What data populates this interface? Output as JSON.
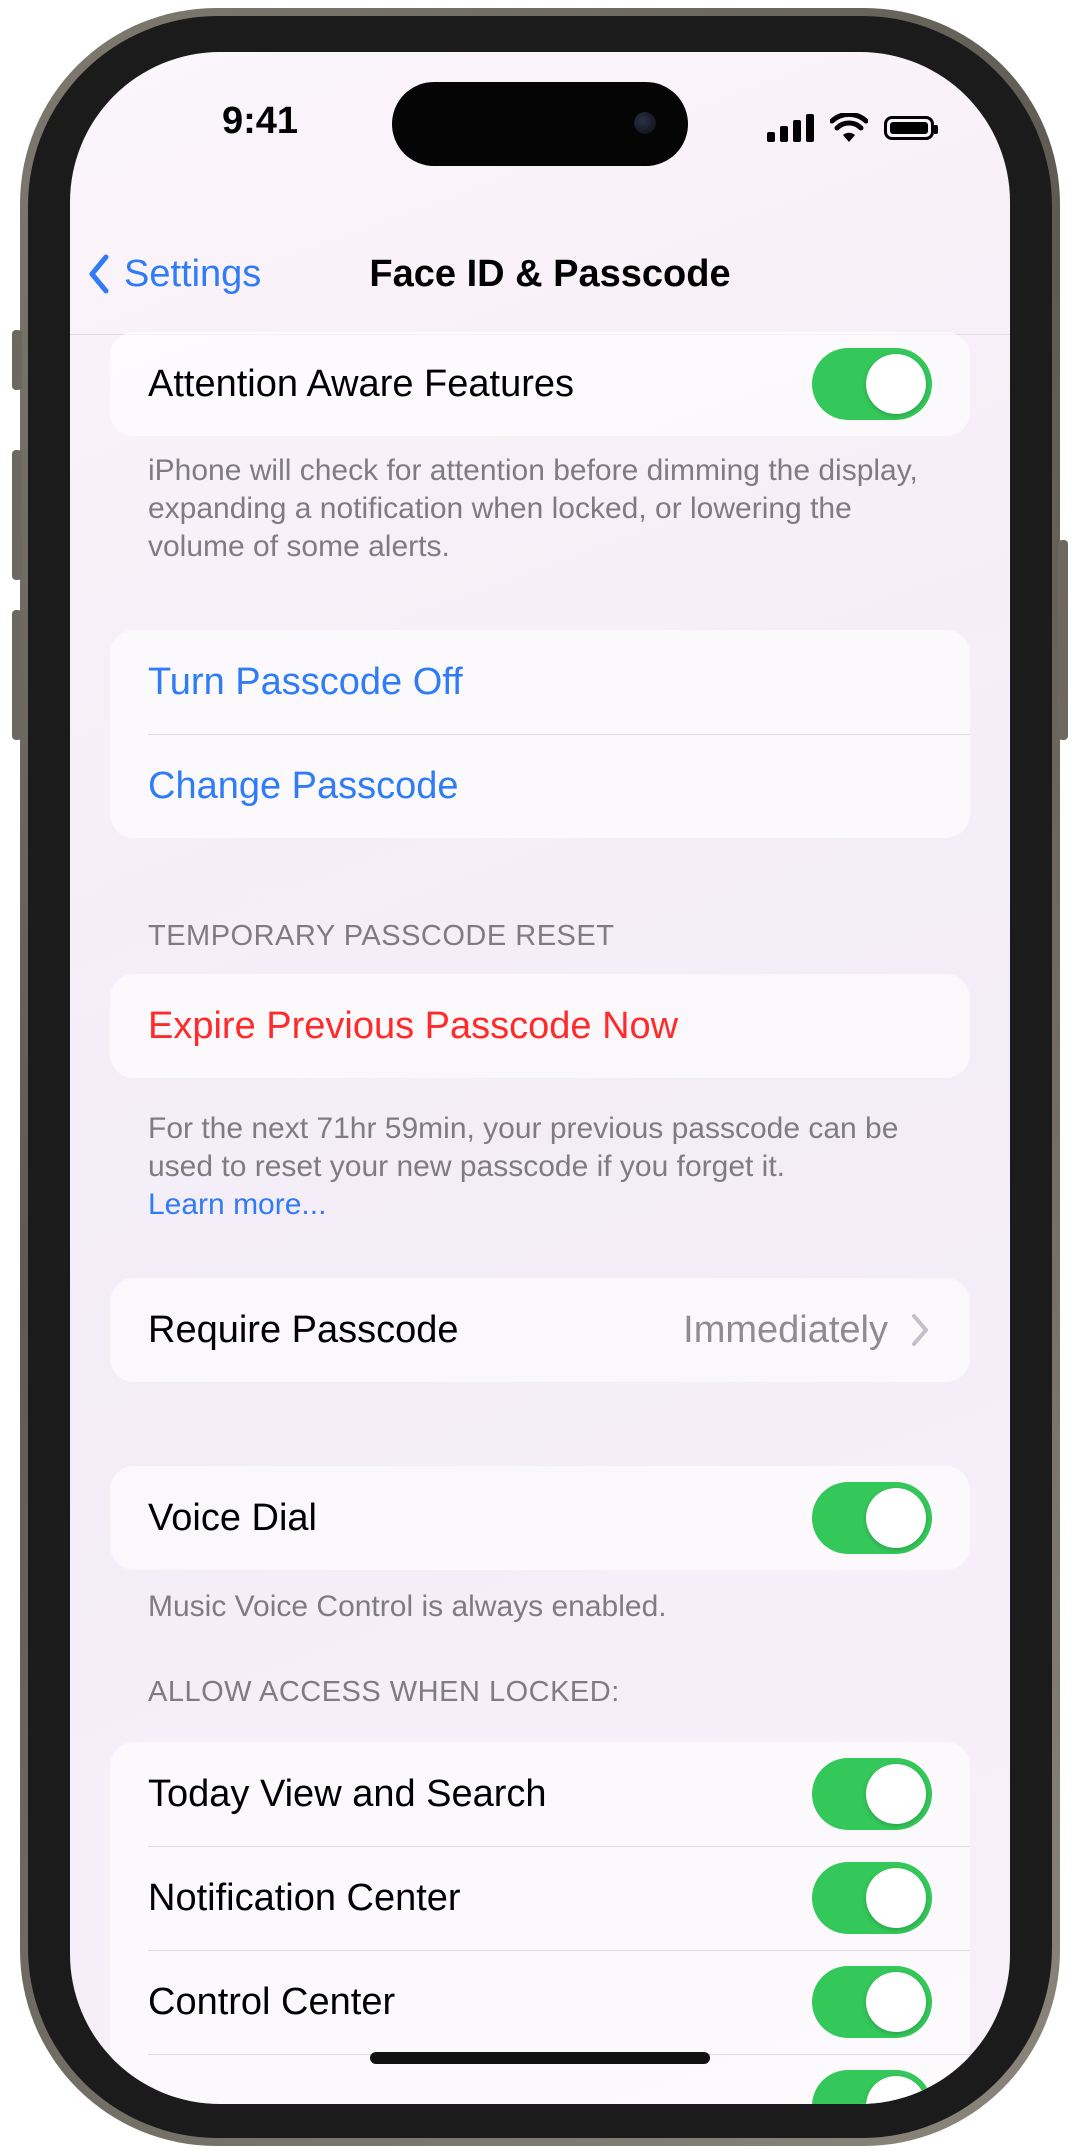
{
  "status_bar": {
    "time": "9:41"
  },
  "nav": {
    "back_label": "Settings",
    "title": "Face ID & Passcode"
  },
  "attention": {
    "label": "Attention Aware Features",
    "enabled": true,
    "footnote": "iPhone will check for attention before dimming the display, expanding a notification when locked, or lowering the volume of some alerts."
  },
  "passcode_actions": {
    "turn_off": "Turn Passcode Off",
    "change": "Change Passcode"
  },
  "temp_reset": {
    "header": "TEMPORARY PASSCODE RESET",
    "expire_label": "Expire Previous Passcode Now",
    "footnote": "For the next 71hr 59min, your previous passcode can be used to reset your new passcode if you forget it.",
    "learn_more": "Learn more..."
  },
  "require_passcode": {
    "label": "Require Passcode",
    "value": "Immediately"
  },
  "voice_dial": {
    "label": "Voice Dial",
    "enabled": true,
    "footnote": "Music Voice Control is always enabled."
  },
  "locked_access": {
    "header": "ALLOW ACCESS WHEN LOCKED:",
    "items": [
      {
        "label": "Today View and Search",
        "enabled": true
      },
      {
        "label": "Notification Center",
        "enabled": true
      },
      {
        "label": "Control Center",
        "enabled": true
      }
    ]
  },
  "colors": {
    "accent": "#2f7cf6",
    "destructive": "#ff2b2b",
    "toggle_on": "#34c759"
  }
}
